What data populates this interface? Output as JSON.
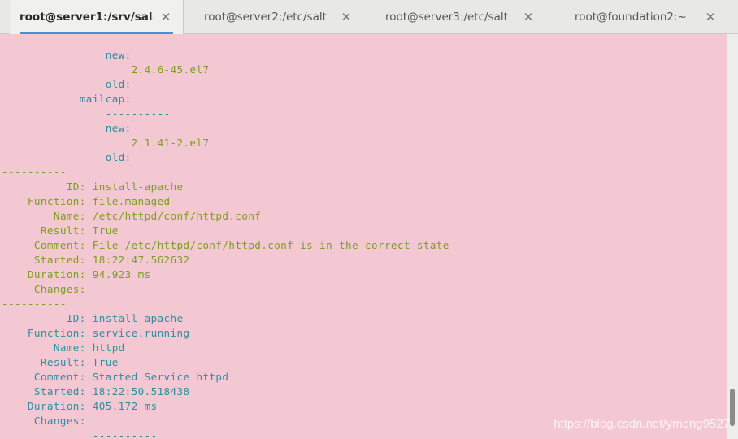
{
  "tabs": [
    {
      "label": "root@server1:/srv/sal...",
      "close": "✕",
      "active": true
    },
    {
      "label": "root@server2:/etc/salt",
      "close": "✕",
      "active": false
    },
    {
      "label": "root@server3:/etc/salt",
      "close": "✕",
      "active": false
    },
    {
      "label": "root@foundation2:~",
      "close": "✕",
      "active": false
    }
  ],
  "terminal": {
    "background": "#f4c8d2",
    "lines": [
      {
        "text": "                ----------",
        "color": "cyan"
      },
      {
        "text": "                new:",
        "color": "cyan"
      },
      {
        "text": "                    2.4.6-45.el7",
        "color": "green"
      },
      {
        "text": "                old:",
        "color": "cyan"
      },
      {
        "text": "            mailcap:",
        "color": "cyan"
      },
      {
        "text": "                ----------",
        "color": "cyan"
      },
      {
        "text": "                new:",
        "color": "cyan"
      },
      {
        "text": "                    2.1.41-2.el7",
        "color": "green"
      },
      {
        "text": "                old:",
        "color": "cyan"
      },
      {
        "text": "----------",
        "color": "green"
      },
      {
        "text": "          ID: install-apache",
        "color": "green"
      },
      {
        "text": "    Function: file.managed",
        "color": "green"
      },
      {
        "text": "        Name: /etc/httpd/conf/httpd.conf",
        "color": "green"
      },
      {
        "text": "      Result: True",
        "color": "green"
      },
      {
        "text": "     Comment: File /etc/httpd/conf/httpd.conf is in the correct state",
        "color": "green"
      },
      {
        "text": "     Started: 18:22:47.562632",
        "color": "green"
      },
      {
        "text": "    Duration: 94.923 ms",
        "color": "green"
      },
      {
        "text": "     Changes:",
        "color": "green"
      },
      {
        "text": "----------",
        "color": "green"
      },
      {
        "text": "          ID: install-apache",
        "color": "cyan"
      },
      {
        "text": "    Function: service.running",
        "color": "cyan"
      },
      {
        "text": "        Name: httpd",
        "color": "cyan"
      },
      {
        "text": "      Result: True",
        "color": "cyan"
      },
      {
        "text": "     Comment: Started Service httpd",
        "color": "cyan"
      },
      {
        "text": "     Started: 18:22:50.518438",
        "color": "cyan"
      },
      {
        "text": "    Duration: 405.172 ms",
        "color": "cyan"
      },
      {
        "text": "     Changes:",
        "color": "cyan"
      },
      {
        "text": "              ----------",
        "color": "cyan"
      }
    ]
  },
  "colors": {
    "green": "#7a9e1e",
    "cyan": "#2a8fa0",
    "tab_active_underline": "#4a90d9"
  },
  "watermark": "https://blog.csdn.net/ymeng9527"
}
